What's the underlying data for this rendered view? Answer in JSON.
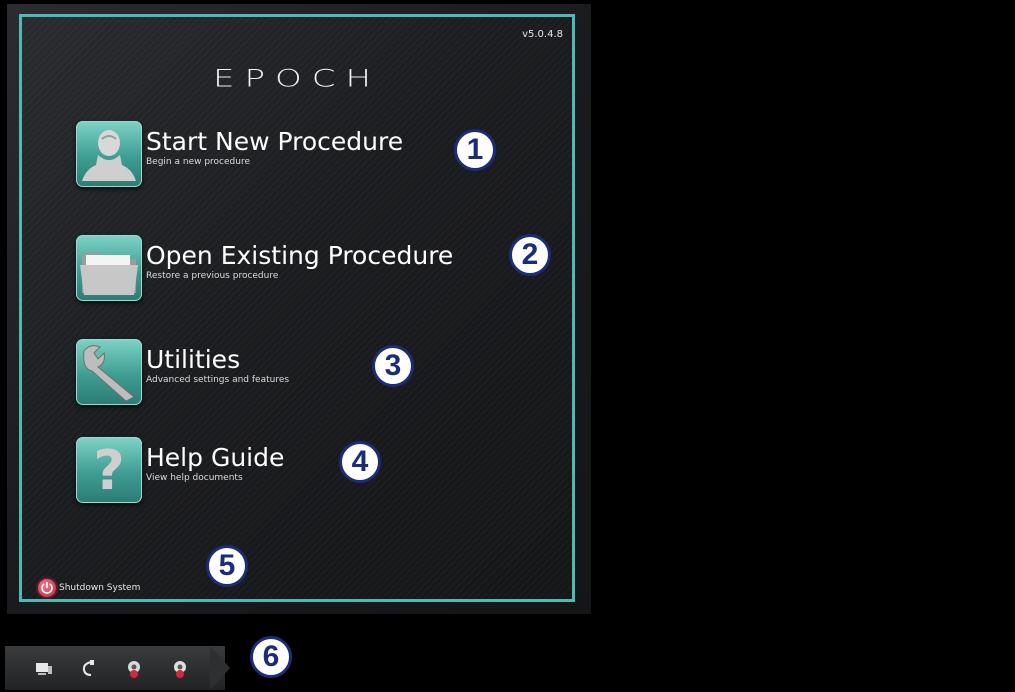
{
  "app": {
    "version": "v5.0.4.8",
    "logo": "EPOCH"
  },
  "menu": [
    {
      "title": "Start New Procedure",
      "subtitle": "Begin a new procedure",
      "icon": "person-bust-icon",
      "badge": "1"
    },
    {
      "title": "Open Existing Procedure",
      "subtitle": "Restore a previous procedure",
      "icon": "folder-icon",
      "badge": "2"
    },
    {
      "title": "Utilities",
      "subtitle": "Advanced settings and features",
      "icon": "wrench-icon",
      "badge": "3"
    },
    {
      "title": "Help Guide",
      "subtitle": "View help documents",
      "icon": "question-mark-icon",
      "badge": "4"
    }
  ],
  "shutdown": {
    "label": "Shutdown System",
    "badge": "5"
  },
  "taskbar": {
    "badge": "6",
    "icons": [
      "monitor-icon",
      "cable-icon",
      "gear-red-icon",
      "gear-white-icon"
    ]
  },
  "colors": {
    "accent": "#4fb9b5",
    "tile": "#3e9d92",
    "badge_border": "#1c2c7a",
    "power": "#c0243a"
  }
}
